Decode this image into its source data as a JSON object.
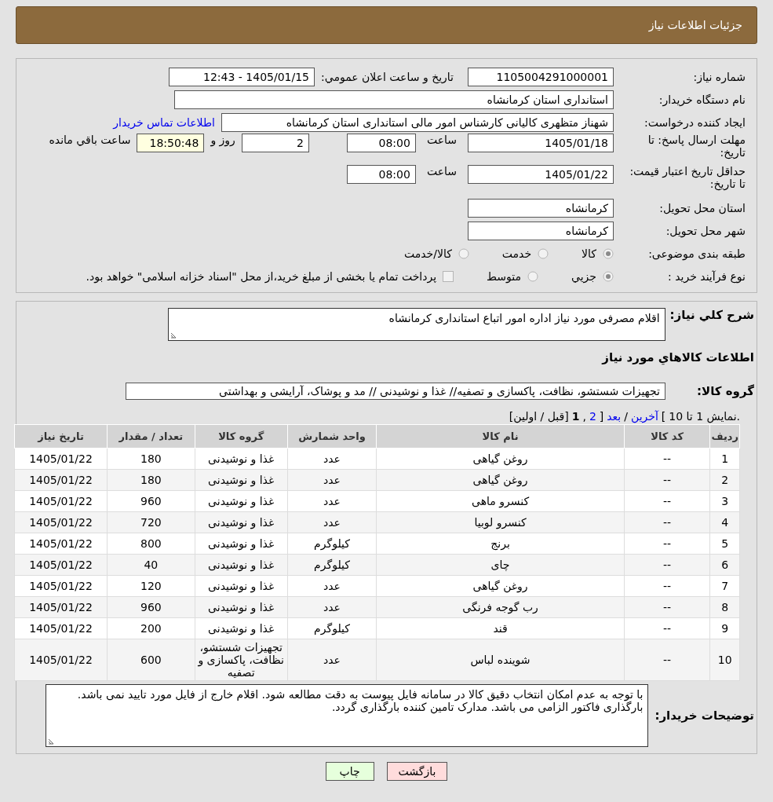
{
  "header": {
    "title": "جزئیات اطلاعات نیاز"
  },
  "details": {
    "need_number": {
      "label": "شماره نیاز:",
      "value": "1105004291000001"
    },
    "announce": {
      "label": "تاریخ و ساعت اعلان عمومي:",
      "value": "1405/01/15 - 12:43"
    },
    "buyer_org": {
      "label": "نام دستگاه خریدار:",
      "value": "استانداری استان کرمانشاه"
    },
    "requester": {
      "label": "ایجاد کننده درخواست:",
      "value": "شهناز متظهری کالیانی کارشناس امور مالی استانداری استان کرمانشاه",
      "link": "اطلاعات تماس خریدار"
    },
    "response_deadline": {
      "label": "مهلت ارسال پاسخ: تا تاریخ:",
      "date": "1405/01/18",
      "time_label": "ساعت",
      "time": "08:00",
      "days": "2",
      "days_label": "روز و",
      "remaining": "18:50:48",
      "remaining_label": "ساعت باقي مانده"
    },
    "price_validity": {
      "label": "حداقل تاریخ اعتبار قیمت: تا تاریخ:",
      "date": "1405/01/22",
      "time_label": "ساعت",
      "time": "08:00"
    },
    "province": {
      "label": "استان محل تحویل:",
      "value": "کرمانشاه"
    },
    "city": {
      "label": "شهر محل تحویل:",
      "value": "کرمانشاه"
    },
    "category": {
      "label": "طبقه بندی موضوعی:",
      "options": [
        {
          "label": "کالا",
          "selected": true
        },
        {
          "label": "خدمت",
          "selected": false
        },
        {
          "label": "کالا/خدمت",
          "selected": false
        }
      ]
    },
    "process": {
      "label": "نوع فرآیند خرید :",
      "options": [
        {
          "label": "جزيي",
          "selected": true
        },
        {
          "label": "متوسط",
          "selected": false
        }
      ],
      "payment": {
        "label": "پرداخت تمام یا بخشی از مبلغ خرید،از محل \"اسناد خزانه اسلامی\" خواهد بود.",
        "checked": false
      }
    }
  },
  "needs": {
    "description": {
      "label": "شرح کلي نیاز:",
      "value": "اقلام مصرفی مورد نیاز اداره امور اتباع استانداری کرمانشاه"
    },
    "goods_title": "اطلاعات کالاهاي مورد نیاز",
    "group": {
      "label": "گروه کالا:",
      "value": "تجهیزات شستشو، نظافت، پاکسازی و تصفیه// غذا و نوشیدنی // مد و پوشاک، آرایشی و بهداشتی"
    },
    "pagination": [
      {
        "text": "نمایش 1 تا 10.",
        "kind": "text"
      },
      {
        "text": "[",
        "kind": "text"
      },
      {
        "text": "آخرین",
        "kind": "link"
      },
      {
        "text": "/",
        "kind": "text"
      },
      {
        "text": "بعد",
        "kind": "link"
      },
      {
        "text": "]",
        "kind": "text"
      },
      {
        "text": "2",
        "kind": "link"
      },
      {
        "text": ",",
        "kind": "text"
      },
      {
        "text": "1",
        "kind": "current"
      },
      {
        "text": "[قبل / اولین]",
        "kind": "text"
      }
    ],
    "table": {
      "columns": [
        "ردیف",
        "کد کالا",
        "نام کالا",
        "واحد شمارش",
        "گروه کالا",
        "تعداد / مقدار",
        "تاریخ نیاز"
      ],
      "rows": [
        [
          "1",
          "--",
          "روغن گیاهی",
          "عدد",
          "غذا و نوشیدنی",
          "180",
          "1405/01/22"
        ],
        [
          "2",
          "--",
          "روغن گیاهی",
          "عدد",
          "غذا و نوشیدنی",
          "180",
          "1405/01/22"
        ],
        [
          "3",
          "--",
          "کنسرو ماهی",
          "عدد",
          "غذا و نوشیدنی",
          "960",
          "1405/01/22"
        ],
        [
          "4",
          "--",
          "کنسرو لوبیا",
          "عدد",
          "غذا و نوشیدنی",
          "720",
          "1405/01/22"
        ],
        [
          "5",
          "--",
          "برنج",
          "کیلوگرم",
          "غذا و نوشیدنی",
          "800",
          "1405/01/22"
        ],
        [
          "6",
          "--",
          "چای",
          "کیلوگرم",
          "غذا و نوشیدنی",
          "40",
          "1405/01/22"
        ],
        [
          "7",
          "--",
          "روغن گیاهی",
          "عدد",
          "غذا و نوشیدنی",
          "120",
          "1405/01/22"
        ],
        [
          "8",
          "--",
          "رب گوجه فرنگی",
          "عدد",
          "غذا و نوشیدنی",
          "960",
          "1405/01/22"
        ],
        [
          "9",
          "--",
          "قند",
          "کیلوگرم",
          "غذا و نوشیدنی",
          "200",
          "1405/01/22"
        ],
        [
          "10",
          "--",
          "شوینده لباس",
          "عدد",
          "تجهیزات شستشو، نظافت، پاکسازی و تصفیه",
          "600",
          "1405/01/22"
        ]
      ]
    },
    "notes": {
      "label": "توضیحات خریدار:",
      "value": "با توجه به عدم امکان انتخاب دقیق کالا در سامانه فایل پیوست به دقت مطالعه شود. اقلام خارج از فایل مورد تایید نمی باشد. بارگذاری فاکتور الزامی می باشد. مدارک تامین کننده بارگذاری گردد."
    }
  },
  "buttons": [
    {
      "label": "بازگشت",
      "kind": "back"
    },
    {
      "label": "چاپ",
      "kind": "print"
    }
  ]
}
